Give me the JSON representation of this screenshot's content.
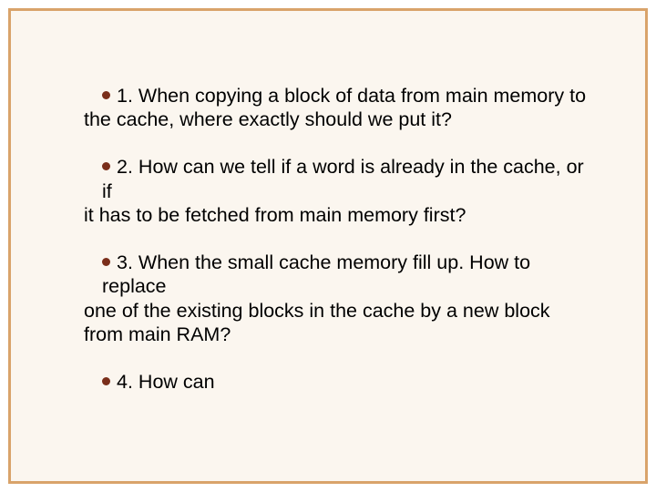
{
  "items": [
    {
      "num": "1.",
      "line1": "When copying a block of data from main memory to",
      "line2": "the cache, where exactly should we put it?"
    },
    {
      "num": "2.",
      "line1": "How can we tell if a word is already in the cache, or if",
      "line2": "it has to be fetched from main memory first?"
    },
    {
      "num": "3.",
      "line1": "When the small cache memory fill up. How to replace",
      "line2": "one of the existing blocks in the cache by a new block from main RAM?"
    }
  ],
  "cutoff": {
    "num": "4.",
    "fragment": "How can "
  }
}
